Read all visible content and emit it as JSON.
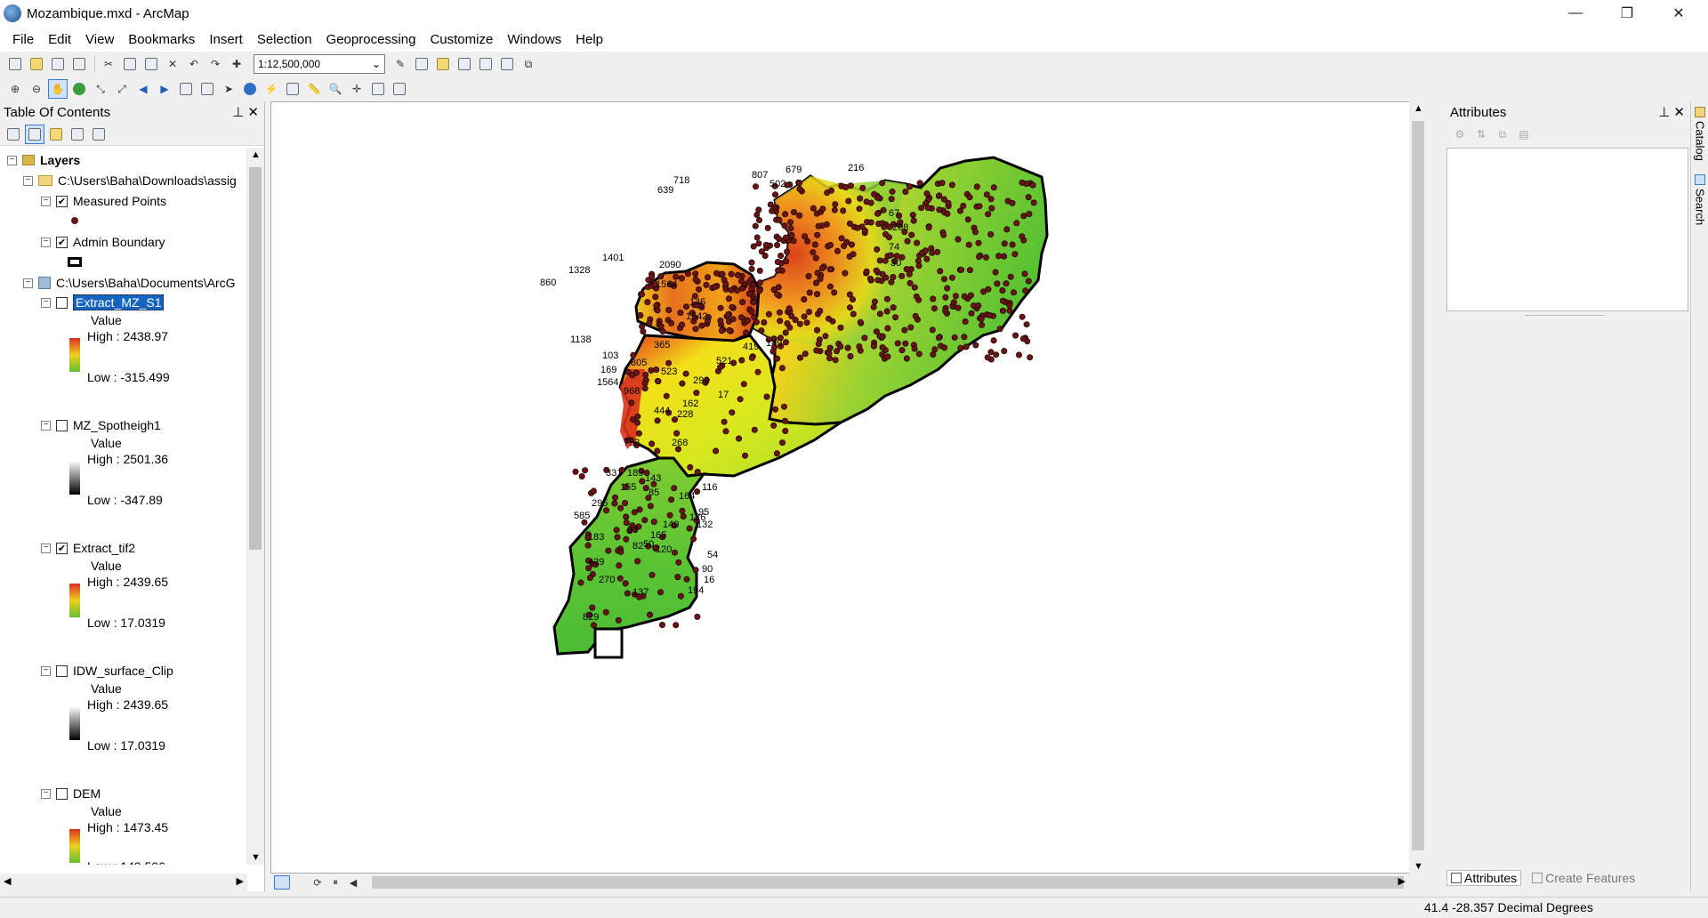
{
  "window": {
    "title": "Mozambique.mxd - ArcMap",
    "minimize": "—",
    "restore": "❐",
    "close": "✕"
  },
  "menu": [
    "File",
    "Edit",
    "View",
    "Bookmarks",
    "Insert",
    "Selection",
    "Geoprocessing",
    "Customize",
    "Windows",
    "Help"
  ],
  "toolbar": {
    "scale": "1:12,500,000"
  },
  "toc": {
    "title": "Table Of Contents",
    "root": "Layers",
    "group1": "C:\\Users\\Baha\\Downloads\\assig",
    "measured_points": "Measured Points",
    "admin_boundary": "Admin Boundary",
    "group2": "C:\\Users\\Baha\\Documents\\ArcG",
    "layers": [
      {
        "name": "Extract_MZ_S1",
        "checked": false,
        "value": "Value",
        "high": "High : 2438.97",
        "low": "Low : -315.499",
        "ramp": "color"
      },
      {
        "name": "MZ_Spotheigh1",
        "checked": false,
        "value": "Value",
        "high": "High : 2501.36",
        "low": "Low : -347.89",
        "ramp": "gray"
      },
      {
        "name": "Extract_tif2",
        "checked": true,
        "value": "Value",
        "high": "High : 2439.65",
        "low": "Low : 17.0319",
        "ramp": "color"
      },
      {
        "name": "IDW_surface_Clip",
        "checked": false,
        "value": "Value",
        "high": "High : 2439.65",
        "low": "Low : 17.0319",
        "ramp": "gray"
      },
      {
        "name": "DEM",
        "checked": false,
        "value": "Value",
        "high": "High : 1473.45",
        "low": "Low : 149.596",
        "ramp": "color"
      }
    ]
  },
  "map": {
    "labels": [
      "807",
      "679",
      "216",
      "718",
      "502",
      "639",
      "67",
      "208",
      "74",
      "30",
      "2090",
      "1401",
      "1328",
      "860",
      "1564",
      "145",
      "1542",
      "1138",
      "149",
      "103",
      "169",
      "1564",
      "805",
      "523",
      "292",
      "17",
      "968",
      "162",
      "444",
      "228",
      "753",
      "268",
      "331",
      "189",
      "143",
      "116",
      "155",
      "85",
      "164",
      "295",
      "585",
      "183",
      "93",
      "149",
      "165",
      "50",
      "82",
      "126",
      "95",
      "132",
      "429",
      "120",
      "54",
      "90",
      "270",
      "137",
      "194",
      "16",
      "829",
      "365",
      "521",
      "419"
    ],
    "colors": {
      "high": "#d9301c",
      "mid": "#f2e11a",
      "low": "#5cc434",
      "point": "#6b1414",
      "boundary": "#000000"
    }
  },
  "attributes": {
    "title": "Attributes",
    "tab_active": "Attributes",
    "tab_inactive": "Create Features"
  },
  "rightstrip": {
    "catalog": "Catalog",
    "search": "Search"
  },
  "status": {
    "coords": "41.4  -28.357 Decimal Degrees"
  }
}
